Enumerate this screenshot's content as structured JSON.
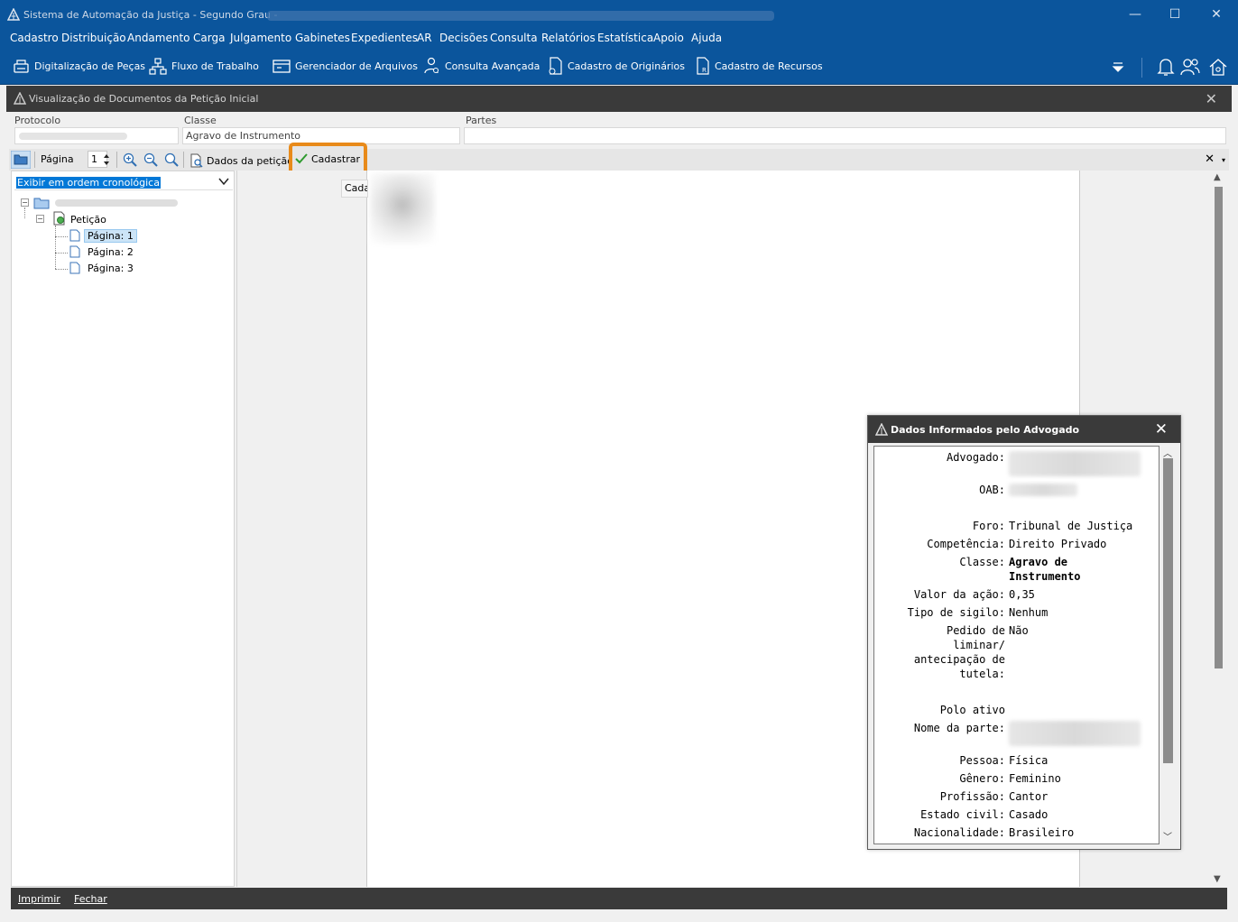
{
  "window": {
    "title": "Sistema de Automação da Justiça - Segundo Grau -"
  },
  "menu": [
    "Cadastro",
    "Distribuição",
    "Andamento",
    "Carga",
    "Julgamento",
    "Gabinetes",
    "Expedientes",
    "AR",
    "Decisões",
    "Consulta",
    "Relatórios",
    "Estatística",
    "Apoio",
    "Ajuda"
  ],
  "toolbar": {
    "items": [
      "Digitalização de Peças",
      "Fluxo de Trabalho",
      "Gerenciador de Arquivos",
      "Consulta Avançada",
      "Cadastro de Originários",
      "Cadastro de Recursos"
    ]
  },
  "panel": {
    "title": "Visualização de Documentos da Petição Inicial"
  },
  "form": {
    "protocolo_label": "Protocolo",
    "classe_label": "Classe",
    "classe_value": "Agravo de Instrumento",
    "partes_label": "Partes"
  },
  "doc_toolbar": {
    "page_label": "Página",
    "page_value": "1",
    "dados_label": "Dados da petição",
    "cadastrar_label": "Cadastrar",
    "tooltip": "Cadastrar"
  },
  "tree": {
    "order_option": "Exibir em ordem cronológica",
    "peticao": "Petição",
    "pages": [
      "Página: 1",
      "Página: 2",
      "Página: 3"
    ]
  },
  "statusbar": {
    "imprimir": "Imprimir",
    "fechar": "Fechar"
  },
  "dialog": {
    "title": "Dados Informados pelo Advogado",
    "fields": {
      "advogado": "Advogado:",
      "oab": "OAB:",
      "foro_k": "Foro:",
      "foro_v": "Tribunal de Justiça",
      "competencia_k": "Competência:",
      "competencia_v": "Direito Privado",
      "classe_k": "Classe:",
      "classe_v": "Agravo de Instrumento",
      "valor_k": "Valor da ação:",
      "valor_v": "0,35",
      "sigilo_k": "Tipo de sigilo:",
      "sigilo_v": "Nenhum",
      "liminar_k": "Pedido de liminar/ antecipação de tutela:",
      "liminar_v": "Não",
      "polo": "Polo ativo",
      "nome_k": "Nome da parte:",
      "pessoa_k": "Pessoa:",
      "pessoa_v": "Física",
      "genero_k": "Gênero:",
      "genero_v": "Feminino",
      "profissao_k": "Profissão:",
      "profissao_v": "Cantor",
      "civil_k": "Estado civil:",
      "civil_v": "Casado",
      "nacionalidade_k": "Nacionalidade:",
      "nacionalidade_v": "Brasileiro"
    }
  },
  "colors": {
    "titlebar": "#0b559c",
    "dark_panel": "#3a3a3a",
    "highlight": "#e88a1a",
    "selection": "#0078d7"
  }
}
